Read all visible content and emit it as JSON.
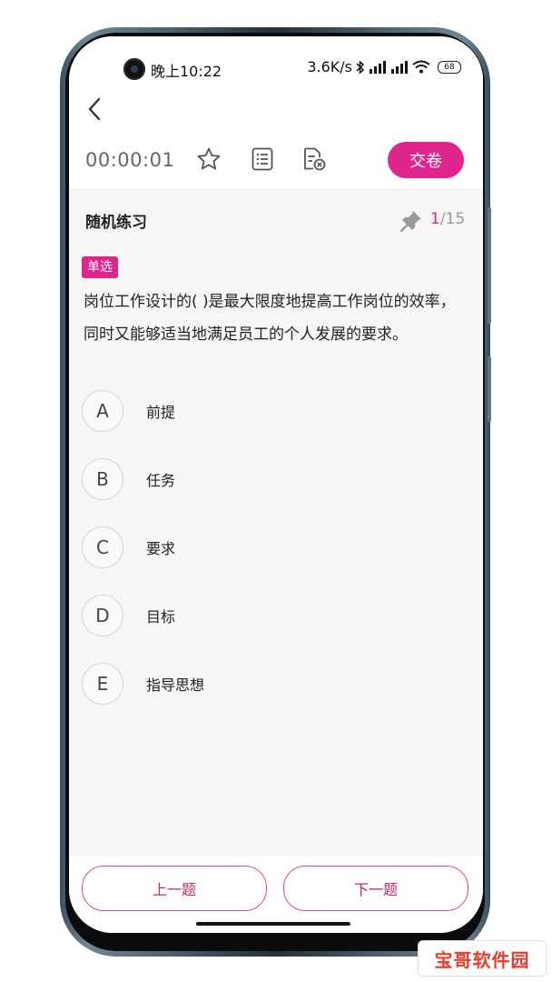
{
  "status_bar": {
    "time": "晚上10:22",
    "network_speed": "3.6K/s",
    "battery": "68"
  },
  "toolbar": {
    "timer": "00:00:01",
    "submit_label": "交卷"
  },
  "section": {
    "title": "随机练习",
    "progress_current": "1",
    "progress_total": "/15"
  },
  "question": {
    "type": "单选",
    "text": "岗位工作设计的( )是最大限度地提高工作岗位的效率，同时又能够适当地满足员工的个人发展的要求。"
  },
  "options": [
    {
      "letter": "A",
      "text": "前提"
    },
    {
      "letter": "B",
      "text": "任务"
    },
    {
      "letter": "C",
      "text": "要求"
    },
    {
      "letter": "D",
      "text": "目标"
    },
    {
      "letter": "E",
      "text": "指导思想"
    }
  ],
  "navigation": {
    "prev_label": "上一题",
    "next_label": "下一题"
  },
  "colors": {
    "accent": "#e0248e",
    "nav_border": "#d94a7e"
  },
  "watermark": "宝哥软件园"
}
